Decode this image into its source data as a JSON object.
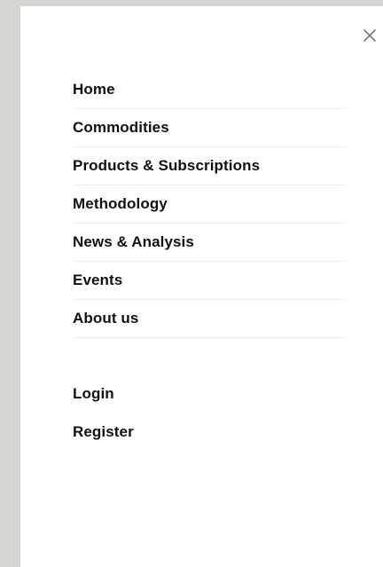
{
  "menu": {
    "close_icon": "close-icon",
    "nav_items": [
      {
        "label": "Home"
      },
      {
        "label": "Commodities"
      },
      {
        "label": "Products & Subscriptions"
      },
      {
        "label": "Methodology"
      },
      {
        "label": "News & Analysis"
      },
      {
        "label": "Events"
      },
      {
        "label": "About us"
      }
    ],
    "account_items": [
      {
        "label": "Login"
      },
      {
        "label": "Register"
      }
    ]
  },
  "colors": {
    "backdrop": "#d5d6d1",
    "panel": "#ffffff",
    "text": "#111111",
    "divider": "#eeeeee"
  }
}
